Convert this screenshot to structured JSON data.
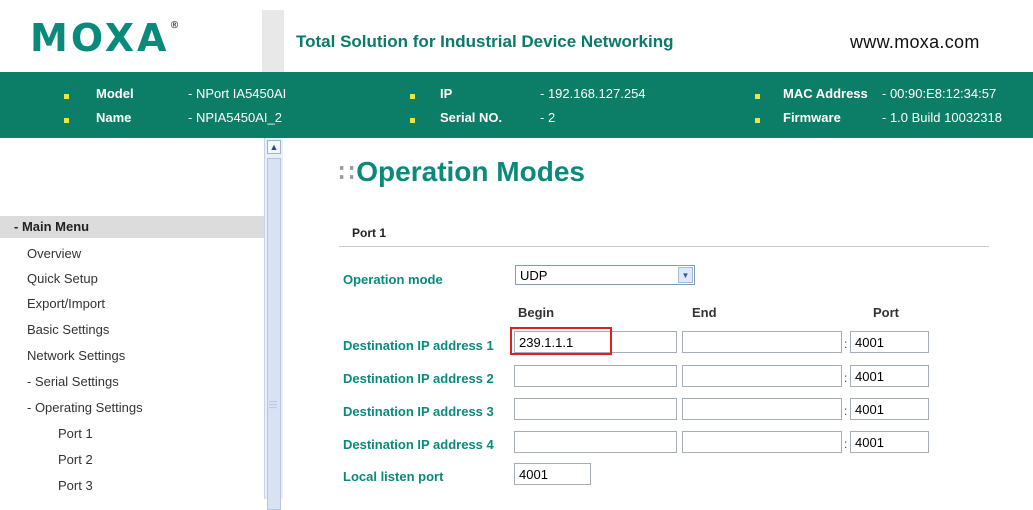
{
  "header": {
    "logo": "MOXA",
    "logo_mark": "®",
    "tagline": "Total Solution for Industrial Device Networking",
    "website": "www.moxa.com"
  },
  "info_bar": {
    "model_label": "Model",
    "model_value": "- NPort IA5450AI",
    "name_label": "Name",
    "name_value": "- NPIA5450AI_2",
    "ip_label": "IP",
    "ip_value": "- 192.168.127.254",
    "serial_label": "Serial NO.",
    "serial_value": "- 2",
    "mac_label": "MAC Address",
    "mac_value": "- 00:90:E8:12:34:57",
    "firmware_label": "Firmware",
    "firmware_value": "- 1.0 Build 10032318"
  },
  "sidebar": {
    "header": "- Main Menu",
    "items": [
      "Overview",
      "Quick Setup",
      "Export/Import",
      "Basic Settings",
      "Network Settings",
      "- Serial Settings",
      "- Operating Settings",
      "Port 1",
      "Port 2",
      "Port 3"
    ]
  },
  "main": {
    "title": "Operation Modes",
    "section": "Port 1",
    "operation_mode_label": "Operation mode",
    "operation_mode_value": "UDP",
    "col_begin": "Begin",
    "col_end": "End",
    "col_port": "Port",
    "destinations": [
      {
        "label": "Destination IP address 1",
        "begin": "239.1.1.1",
        "end": "",
        "port": "4001"
      },
      {
        "label": "Destination IP address 2",
        "begin": "",
        "end": "",
        "port": "4001"
      },
      {
        "label": "Destination IP address 3",
        "begin": "",
        "end": "",
        "port": "4001"
      },
      {
        "label": "Destination IP address 4",
        "begin": "",
        "end": "",
        "port": "4001"
      }
    ],
    "colon": ":",
    "local_listen_label": "Local listen port",
    "local_listen_value": "4001"
  },
  "colors": {
    "brand_teal": "#0a8a7a",
    "info_bar_bg": "#0c7d67",
    "bullet": "#f4e23a",
    "highlight": "#e02020"
  }
}
